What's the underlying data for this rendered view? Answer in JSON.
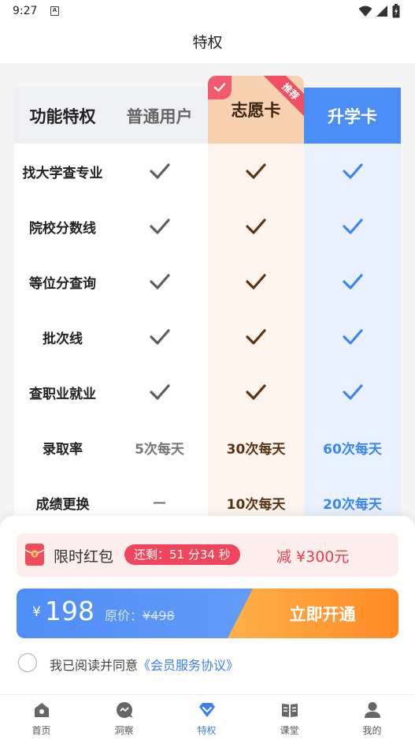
{
  "status": {
    "time": "9:27",
    "sim_glyph": "A"
  },
  "header": {
    "title": "特权"
  },
  "table": {
    "headers": [
      "功能特权",
      "普通用户",
      "志愿卡",
      "升学卡"
    ],
    "ribbon": "推荐",
    "rows": [
      {
        "feature": "找大学查专业",
        "normal": "check",
        "zhiyuan": "check",
        "shengxue": "check"
      },
      {
        "feature": "院校分数线",
        "normal": "check",
        "zhiyuan": "check",
        "shengxue": "check"
      },
      {
        "feature": "等位分查询",
        "normal": "check",
        "zhiyuan": "check",
        "shengxue": "check"
      },
      {
        "feature": "批次线",
        "normal": "check",
        "zhiyuan": "check",
        "shengxue": "check"
      },
      {
        "feature": "查职业就业",
        "normal": "check",
        "zhiyuan": "check",
        "shengxue": "check"
      },
      {
        "feature": "录取率",
        "normal": "5次每天",
        "zhiyuan": "30次每天",
        "shengxue": "60次每天"
      },
      {
        "feature": "成绩更换",
        "normal": "—",
        "zhiyuan": "10次每天",
        "shengxue": "20次每天"
      }
    ]
  },
  "promo": {
    "label": "限时红包",
    "timer": "还剩：51 分34 秒",
    "discount": "减 ¥300元"
  },
  "purchase": {
    "currency": "¥",
    "price": "198",
    "original_label": "原价：",
    "original_price": "¥498",
    "button": "立即开通"
  },
  "agreement": {
    "text": "我已阅读并同意",
    "link": "《会员服务协议》"
  },
  "tabs": [
    {
      "label": "首页",
      "icon": "home-icon"
    },
    {
      "label": "洞察",
      "icon": "insight-icon"
    },
    {
      "label": "特权",
      "icon": "privilege-icon",
      "active": true
    },
    {
      "label": "课堂",
      "icon": "classroom-icon"
    },
    {
      "label": "我的",
      "icon": "profile-icon"
    }
  ],
  "colors": {
    "primary_blue": "#4a8ef5",
    "accent_orange": "#ff8a25",
    "promo_red": "#f0455b",
    "zhiyuan_brown": "#5a3410"
  }
}
